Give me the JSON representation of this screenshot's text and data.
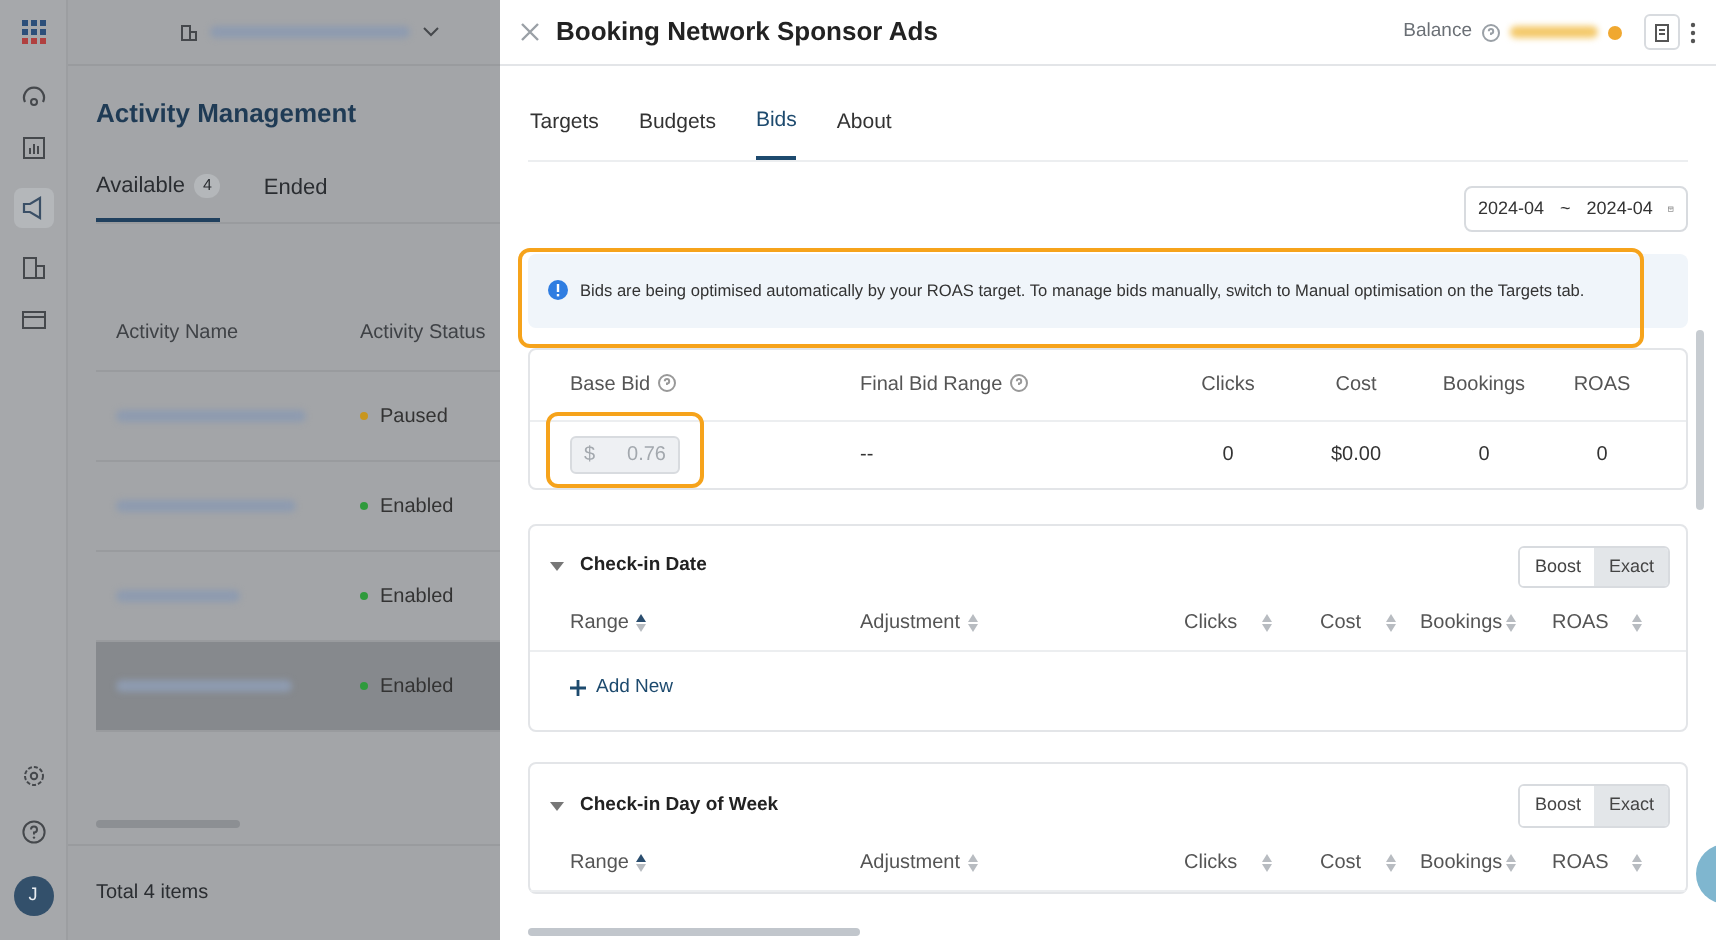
{
  "background": {
    "title": "Activity Management",
    "tabs": [
      {
        "label": "Available",
        "count": "4",
        "selected": true
      },
      {
        "label": "Ended",
        "selected": false
      }
    ],
    "table": {
      "columns": [
        "Activity Name",
        "Activity Status"
      ],
      "rows": [
        {
          "status": "Paused",
          "color": "#c8961e",
          "selected": false
        },
        {
          "status": "Enabled",
          "color": "#2f9a3c",
          "selected": false
        },
        {
          "status": "Enabled",
          "color": "#2f9a3c",
          "selected": false
        },
        {
          "status": "Enabled",
          "color": "#2f9a3c",
          "selected": true
        }
      ]
    },
    "footer": "Total 4 items",
    "avatar": "J"
  },
  "drawer": {
    "title": "Booking Network Sponsor Ads",
    "balance_label": "Balance",
    "tabs": [
      {
        "label": "Targets",
        "selected": false
      },
      {
        "label": "Budgets",
        "selected": false
      },
      {
        "label": "Bids",
        "selected": true
      },
      {
        "label": "About",
        "selected": false
      }
    ],
    "date_range": {
      "start": "2024-04",
      "separator": "~",
      "end": "2024-04"
    },
    "notice": "Bids are being optimised automatically by your ROAS target. To manage bids manually, switch to Manual optimisation on the Targets tab.",
    "base_table": {
      "columns": [
        {
          "label": "Base Bid",
          "help": true
        },
        {
          "label": "Final Bid Range",
          "help": true
        },
        {
          "label": "Clicks",
          "help": false
        },
        {
          "label": "Cost",
          "help": false
        },
        {
          "label": "Bookings",
          "help": false
        },
        {
          "label": "ROAS",
          "help": false
        }
      ],
      "row": {
        "currency": "$",
        "base_bid": "0.76",
        "cells": [
          "--",
          "0",
          "$0.00",
          "0",
          "0"
        ]
      }
    },
    "sections": [
      {
        "title": "Check-in Date",
        "expanded": true,
        "modes": [
          {
            "label": "Boost",
            "selected": false
          },
          {
            "label": "Exact",
            "selected": true
          }
        ],
        "columns": [
          {
            "label": "Range",
            "sorted": true
          },
          {
            "label": "Adjustment",
            "sorted": false
          },
          {
            "label": "Clicks",
            "sorted": false
          },
          {
            "label": "Cost",
            "sorted": false
          },
          {
            "label": "Bookings",
            "sorted": false
          },
          {
            "label": "ROAS",
            "sorted": false
          }
        ],
        "add_label": "Add New"
      },
      {
        "title": "Check-in Day of Week",
        "expanded": true,
        "modes": [
          {
            "label": "Boost",
            "selected": false
          },
          {
            "label": "Exact",
            "selected": true
          }
        ],
        "columns": [
          {
            "label": "Range",
            "sorted": true
          },
          {
            "label": "Adjustment",
            "sorted": false
          },
          {
            "label": "Clicks",
            "sorted": false
          },
          {
            "label": "Cost",
            "sorted": false
          },
          {
            "label": "Bookings",
            "sorted": false
          },
          {
            "label": "ROAS",
            "sorted": false
          }
        ]
      }
    ]
  }
}
